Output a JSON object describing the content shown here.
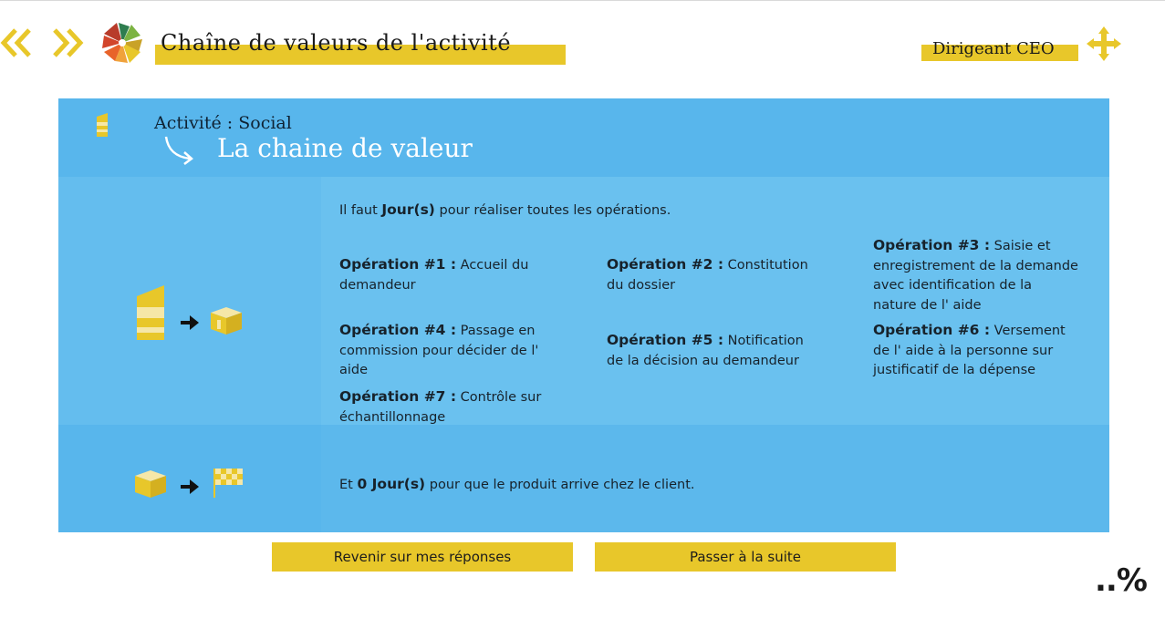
{
  "header": {
    "title": "Chaîne de valeurs de l'activité",
    "role": "Dirigeant CEO",
    "nav_back_icon": "double-chevron-left-icon",
    "nav_forward_icon": "double-chevron-right-icon",
    "move_icon": "four-arrows-move-icon"
  },
  "panel": {
    "activity_label": "Activité : Social",
    "chain_title": "La chaine de valeur",
    "days_prefix": "Il faut ",
    "days_bold": "Jour(s)",
    "days_suffix": " pour réaliser toutes les opérations.",
    "operations": [
      {
        "label": "Opération #1 :",
        "text": " Accueil du demandeur"
      },
      {
        "label": "Opération #2 :",
        "text": " Constitution du dossier"
      },
      {
        "label": "Opération #3 :",
        "text": " Saisie et enregistrement de la demande avec identification de la nature de l' aide"
      },
      {
        "label": "Opération #4 :",
        "text": " Passage en commission pour décider de l' aide"
      },
      {
        "label": "Opération #5 :",
        "text": " Notification de la décision au demandeur"
      },
      {
        "label": "Opération #6 :",
        "text": " Versement de l' aide à la personne sur justificatif de la dépense"
      },
      {
        "label": "Opération #7 :",
        "text": " Contrôle sur échantillonnage"
      }
    ],
    "client_prefix": "Et ",
    "client_bold": "0 Jour(s)",
    "client_suffix": " pour que le produit arrive chez le client."
  },
  "buttons": {
    "back": "Revenir sur mes réponses",
    "next": "Passer à la suite"
  },
  "progress_text": "..%",
  "colors": {
    "accent_yellow": "#e8c72a",
    "panel_blue": "#5cb8ec",
    "panel_blue_light": "#6ac1ef"
  }
}
